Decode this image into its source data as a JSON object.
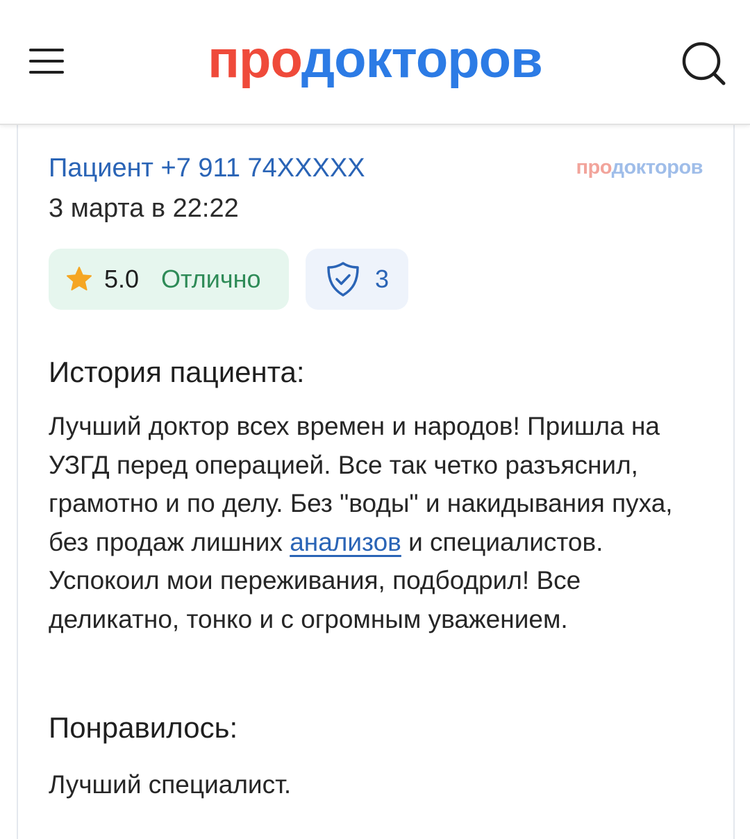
{
  "header": {
    "logo_part1": "про",
    "logo_part2": "докторов",
    "menu_icon": "hamburger-icon",
    "search_icon": "search-icon"
  },
  "review": {
    "author": "Пациент +7 911 74XXXXX",
    "date": "3 марта в 22:22",
    "source_logo_part1": "про",
    "source_logo_part2": "докторов",
    "rating": {
      "icon": "star-icon",
      "value": "5.0",
      "label": "Отлично"
    },
    "verification": {
      "icon": "shield-check-icon",
      "count": "3"
    },
    "history_title": "История пациента:",
    "story": {
      "text_before_link": "Лучший доктор всех времен и народов! Пришла на УЗГД перед операцией. Все так четко разъяснил, грамотно и по делу. Без \"воды\" и накидывания пуха, без продаж лишних ",
      "link_text": "анализов",
      "text_after_link": " и специалистов. Успокоил мои переживания, подбодрил! Все деликатно, тонко и с огромным уважением."
    },
    "liked_title": "Понравилось:",
    "liked_text": "Лучший специалист."
  },
  "colors": {
    "logo_red": "#ef4a3a",
    "logo_blue": "#2c7be5",
    "link_blue": "#2a64b6",
    "rating_green": "#2e8b57",
    "rating_bg": "#e6f6ee",
    "verify_bg": "#eef3fb",
    "star": "#f5a623"
  }
}
